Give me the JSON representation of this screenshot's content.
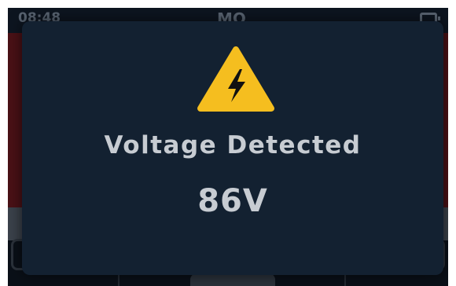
{
  "status_bar": {
    "time": "08:48",
    "mode": "MΩ",
    "battery_icon": "battery-icon"
  },
  "alert": {
    "icon": "high-voltage-warning-icon",
    "icon_color": "#f5be1f",
    "title": "Voltage Detected",
    "value": "86V"
  },
  "colors": {
    "dialog_background": "#132131",
    "text": "#c7ccd2",
    "dimmed_red_band": "#4a1116"
  }
}
